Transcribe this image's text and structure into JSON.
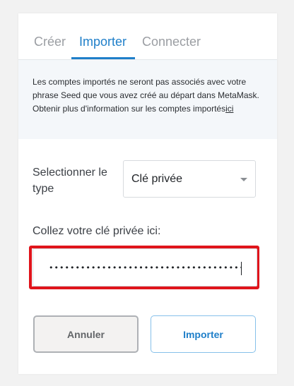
{
  "tabs": [
    {
      "label": "Créer",
      "active": false
    },
    {
      "label": "Importer",
      "active": true
    },
    {
      "label": "Connecter",
      "active": false
    }
  ],
  "notice": {
    "text": "Les comptes importés ne seront pas associés avec votre phrase Seed que vous avez créé au départ dans MetaMask. Obtenir plus d'information sur les comptes importés",
    "link": "ici"
  },
  "type_field": {
    "label": "Selectionner le type",
    "selected": "Clé privée"
  },
  "key_field": {
    "label": "Collez votre clé privée ici:",
    "value": "••••••••••••••••••••••••••••••••••••••••••••••••••••"
  },
  "buttons": {
    "cancel": "Annuler",
    "import": "Importer"
  },
  "colors": {
    "accent": "#1f7fc9",
    "highlight": "#e0141b"
  }
}
